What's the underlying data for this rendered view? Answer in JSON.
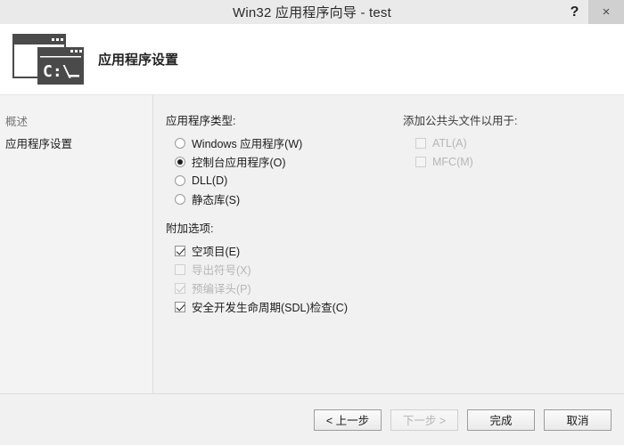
{
  "titlebar": {
    "title": "Win32 应用程序向导 - test",
    "help_label": "?",
    "close_label": "×"
  },
  "header": {
    "caption": "应用程序设置",
    "icon": "console-window-icon",
    "icon_prompt": "C:\\"
  },
  "sidebar": {
    "items": [
      {
        "label": "概述",
        "state": "muted"
      },
      {
        "label": "应用程序设置",
        "state": "active"
      }
    ]
  },
  "main": {
    "app_type": {
      "label": "应用程序类型:",
      "options": [
        {
          "label": "Windows 应用程序(W)",
          "checked": false,
          "enabled": true
        },
        {
          "label": "控制台应用程序(O)",
          "checked": true,
          "enabled": true
        },
        {
          "label": "DLL(D)",
          "checked": false,
          "enabled": true
        },
        {
          "label": "静态库(S)",
          "checked": false,
          "enabled": true
        }
      ]
    },
    "additional": {
      "label": "附加选项:",
      "options": [
        {
          "label": "空项目(E)",
          "checked": true,
          "enabled": true
        },
        {
          "label": "导出符号(X)",
          "checked": false,
          "enabled": false
        },
        {
          "label": "预编译头(P)",
          "checked": true,
          "enabled": false
        },
        {
          "label": "安全开发生命周期(SDL)检查(C)",
          "checked": true,
          "enabled": true
        }
      ]
    },
    "headers": {
      "label": "添加公共头文件以用于:",
      "options": [
        {
          "label": "ATL(A)",
          "checked": false,
          "enabled": false
        },
        {
          "label": "MFC(M)",
          "checked": false,
          "enabled": false
        }
      ]
    }
  },
  "footer": {
    "buttons": [
      {
        "label": "< 上一步",
        "enabled": true
      },
      {
        "label": "下一步 >",
        "enabled": false
      },
      {
        "label": "完成",
        "enabled": true
      },
      {
        "label": "取消",
        "enabled": true
      }
    ]
  },
  "colors": {
    "titlebar_bg": "#eaeaea",
    "header_bg": "#ffffff",
    "panel_bg": "#f1f1f1",
    "sidebar_bg": "#f3f3f3",
    "icon_dark": "#4a4a4a",
    "text": "#1c1c1c",
    "disabled_text": "#b6b6b6"
  }
}
